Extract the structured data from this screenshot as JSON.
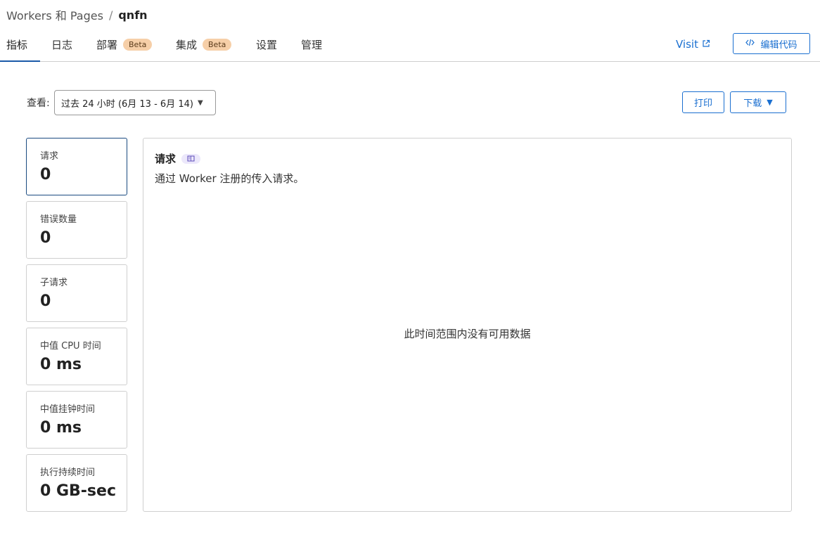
{
  "breadcrumb": {
    "parent": "Workers 和 Pages",
    "separator": "/",
    "current": "qnfn"
  },
  "tabs": [
    {
      "label": "指标"
    },
    {
      "label": "日志"
    },
    {
      "label": "部署",
      "badge": "Beta"
    },
    {
      "label": "集成",
      "badge": "Beta"
    },
    {
      "label": "设置"
    },
    {
      "label": "管理"
    }
  ],
  "header_actions": {
    "visit_label": "Visit",
    "edit_code_label": "编辑代码"
  },
  "toolbar": {
    "view_label": "查看:",
    "time_range": "过去 24 小时 (6月 13 - 6月 14)",
    "print_label": "打印",
    "download_label": "下载"
  },
  "metrics": [
    {
      "label": "请求",
      "value": "0"
    },
    {
      "label": "错误数量",
      "value": "0"
    },
    {
      "label": "子请求",
      "value": "0"
    },
    {
      "label": "中值 CPU 时间",
      "value": "0 ms"
    },
    {
      "label": "中值挂钟时间",
      "value": "0 ms"
    },
    {
      "label": "执行持续时间",
      "value": "0 GB-sec"
    }
  ],
  "panel": {
    "title": "请求",
    "description": "通过 Worker 注册的传入请求。",
    "empty_message": "此时间范围内没有可用数据"
  },
  "colors": {
    "accent": "#1a6fd0",
    "badge_bg": "#f6cfa8",
    "active_tab_underline": "#1a5aa8"
  },
  "icons": {
    "external_link": "external-link-icon",
    "code": "code-icon",
    "book": "book-icon",
    "caret": "caret-down-icon"
  }
}
